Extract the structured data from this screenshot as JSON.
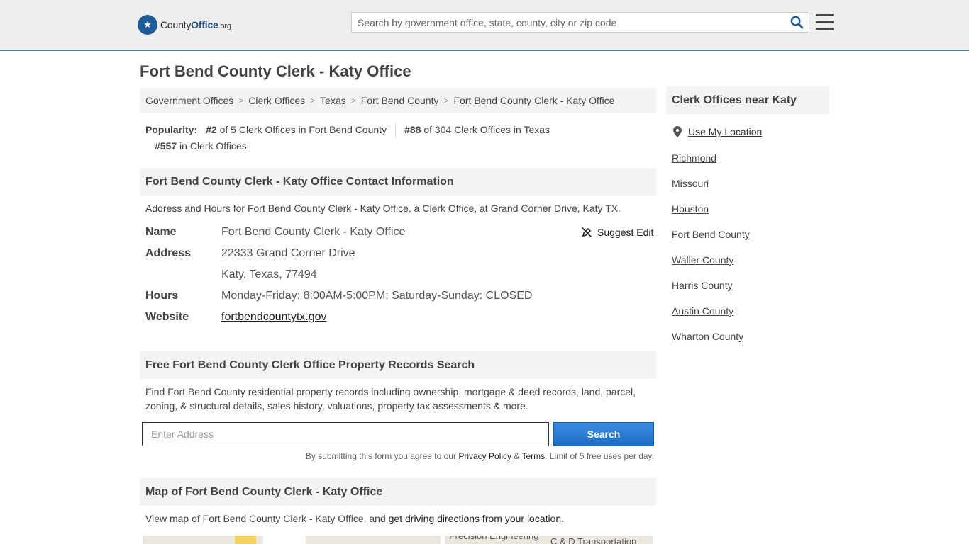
{
  "header": {
    "logo_prefix": "County",
    "logo_bold": "Office",
    "logo_tld": ".org",
    "search_placeholder": "Search by government office, state, county, city or zip code"
  },
  "page_title": "Fort Bend County Clerk - Katy Office",
  "breadcrumb": [
    "Government Offices",
    "Clerk Offices",
    "Texas",
    "Fort Bend County",
    "Fort Bend County Clerk - Katy Office"
  ],
  "popularity": {
    "label": "Popularity:",
    "items": [
      {
        "rank": "#2",
        "text": " of 5 Clerk Offices in Fort Bend County"
      },
      {
        "rank": "#88",
        "text": " of 304 Clerk Offices in Texas"
      },
      {
        "rank": "#557",
        "text": " in Clerk Offices"
      }
    ]
  },
  "contact": {
    "heading": "Fort Bend County Clerk - Katy Office Contact Information",
    "description": "Address and Hours for Fort Bend County Clerk - Katy Office, a Clerk Office, at Grand Corner Drive, Katy TX.",
    "suggest_edit": "Suggest Edit",
    "rows": {
      "name_label": "Name",
      "name_value": "Fort Bend County Clerk - Katy Office",
      "address_label": "Address",
      "address_line1": "22333 Grand Corner Drive",
      "address_line2": "Katy, Texas, 77494",
      "hours_label": "Hours",
      "hours_value": "Monday-Friday: 8:00AM-5:00PM; Saturday-Sunday: CLOSED",
      "website_label": "Website",
      "website_value": "fortbendcountytx.gov"
    }
  },
  "property": {
    "heading": "Free Fort Bend County Clerk Office Property Records Search",
    "description": "Find Fort Bend County residential property records including ownership, mortgage & deed records, land, parcel, zoning, & structural details, sales history, valuations, property tax assessments & more.",
    "input_placeholder": "Enter Address",
    "button_label": "Search",
    "disclaimer_pre": "By submitting this form you agree to our ",
    "privacy": "Privacy Policy",
    "amp": " & ",
    "terms": "Terms",
    "disclaimer_post": ". Limit of 5 free uses per day."
  },
  "map": {
    "heading": "Map of Fort Bend County Clerk - Katy Office",
    "text_pre": "View map of Fort Bend County Clerk - Katy Office, and ",
    "link": "get driving directions from your location",
    "text_post": ".",
    "label_1": "Precision Engineering",
    "label_2": "C & D Transportation"
  },
  "sidebar": {
    "heading": "Clerk Offices near Katy",
    "use_location": "Use My Location",
    "links": [
      "Richmond",
      "Missouri",
      "Houston",
      "Fort Bend County",
      "Waller County",
      "Harris County",
      "Austin County",
      "Wharton County"
    ]
  },
  "colors": {
    "accent_blue": "#1e6cc4",
    "header_bg": "#eeeeee",
    "section_bg": "#f3f3f3"
  }
}
